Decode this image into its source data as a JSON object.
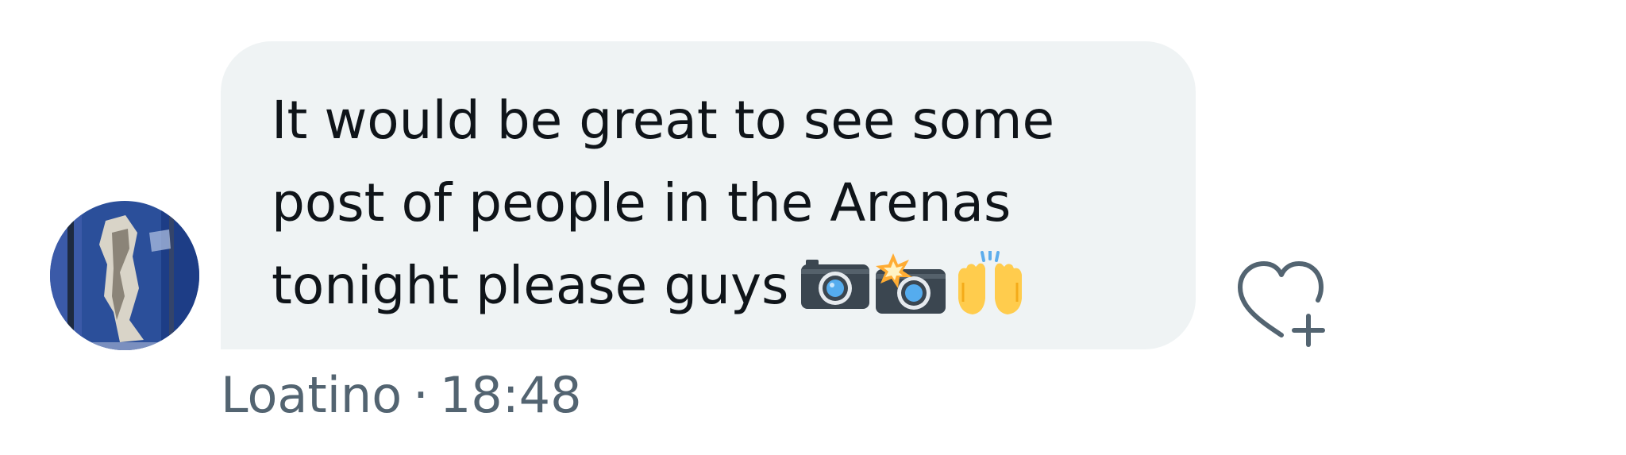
{
  "message": {
    "lines": [
      "It would be great to see some",
      "post of people in the Arenas",
      "tonight please guys"
    ],
    "emoji": [
      "camera-icon",
      "camera-flash-icon",
      "raising-hands-icon"
    ]
  },
  "meta": {
    "author": "Loatino",
    "separator": "·",
    "time": "18:48"
  },
  "actions": {
    "react_icon": "heart-plus-icon"
  },
  "colors": {
    "bubble_bg": "#eff3f4",
    "text": "#0f1419",
    "secondary": "#536471"
  }
}
